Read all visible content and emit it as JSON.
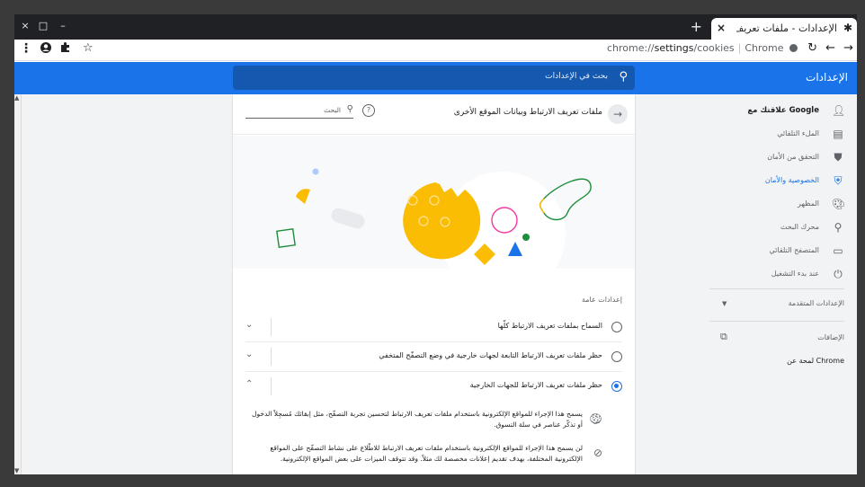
{
  "window": {
    "close_glyph": "×",
    "restore_glyph": "□",
    "minimize_glyph": "–"
  },
  "tab": {
    "title": "الإعدادات - ملفات تعريف الارتباط",
    "close_glyph": "×",
    "icon": "gear-icon",
    "new_tab_glyph": "+"
  },
  "toolbar": {
    "url_prefix": "chrome://",
    "url_path": "settings",
    "url_suffix": "/cookies",
    "product": "Chrome",
    "icons": [
      "menu-icon",
      "profile-icon",
      "extensions-icon",
      "bookmark-star-icon",
      "reload-icon",
      "back-icon",
      "forward-icon"
    ]
  },
  "header": {
    "title": "الإعدادات",
    "search_placeholder": "بحث في الإعدادات"
  },
  "sidebar": {
    "items": [
      {
        "label": "علاقتك مع Google",
        "icon": "person-icon"
      },
      {
        "label": "الملء التلقائي",
        "icon": "clipboard-icon"
      },
      {
        "label": "التحقق من الأمان",
        "icon": "shield-check-icon"
      },
      {
        "label": "الخصوصية والأمان",
        "icon": "shield-icon"
      },
      {
        "label": "المظهر",
        "icon": "palette-icon"
      },
      {
        "label": "محرك البحث",
        "icon": "search-icon"
      },
      {
        "label": "المتصفح التلقائي",
        "icon": "browser-icon"
      },
      {
        "label": "عند بدء التشغيل",
        "icon": "power-icon"
      }
    ],
    "advanced_label": "الإعدادات المتقدمة",
    "extensions_label": "الإضافات",
    "about_label": "لمحة عن Chrome"
  },
  "card": {
    "title": "ملفات تعريف الارتباط وبيانات الموقع الأخرى",
    "search_placeholder": "البحث",
    "section_label": "إعدادات عامة",
    "options": [
      {
        "label": "السماح بملفات تعريف الارتباط كلّها",
        "selected": false,
        "expanded": false
      },
      {
        "label": "حظر ملفات تعريف الارتباط التابعة لجهات خارجية في وضع التصفّح المتخفي",
        "selected": false,
        "expanded": false
      },
      {
        "label": "حظر ملفات تعريف الارتباط للجهات الخارجية",
        "selected": true,
        "expanded": true
      }
    ],
    "details": [
      {
        "icon": "cookie-icon",
        "text": "يسمح هذا الإجراء للمواقع الإلكترونية باستخدام ملفات تعريف الارتباط لتحسين تجربة التصفّح، مثل إبقائك مُسجِلاً الدخول أو تذكّر عناصر في سلة التسوق."
      },
      {
        "icon": "block-icon",
        "text": "لن يسمح هذا الإجراء للمواقع الإلكترونية باستخدام ملفات تعريف الارتباط للاطّلاع على نشاط التصفّح على المواقع الإلكترونية المختلفة، بهدف تقديم إعلانات مخصصة لك مثلاً. وقد تتوقف الميزات على بعض المواقع الإلكترونية."
      }
    ]
  },
  "colors": {
    "accent": "#1a73e8",
    "titlebar": "#202124",
    "illustration_yellow": "#fbbc04",
    "illustration_green": "#1e8e3e",
    "illustration_pink": "#f439a0"
  }
}
